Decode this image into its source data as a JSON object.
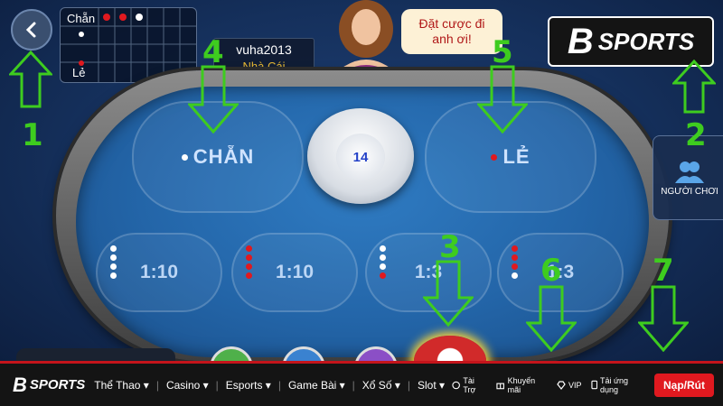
{
  "history": {
    "row_even": "Chẵn",
    "row_odd": "Lẻ"
  },
  "dealer": {
    "username": "vuha2013",
    "role": "Nhà Cái"
  },
  "speech": "Đặt cược đi anh ơi!",
  "brand": {
    "b": "B",
    "sports": "SPORTS"
  },
  "bets": {
    "even": "CHẴN",
    "odd": "LẺ"
  },
  "bowl": {
    "count": "14"
  },
  "sidebar": {
    "players": "NGƯỜI CHƠI"
  },
  "odds": [
    {
      "label": "1:10",
      "dots": [
        "white",
        "white",
        "white",
        "white"
      ]
    },
    {
      "label": "1:10",
      "dots": [
        "red",
        "red",
        "red",
        "red"
      ]
    },
    {
      "label": "1:3",
      "dots": [
        "white",
        "white",
        "white",
        "red"
      ]
    },
    {
      "label": "1:3",
      "dots": [
        "red",
        "red",
        "red",
        "white"
      ]
    }
  ],
  "annotations": [
    "1",
    "2",
    "3",
    "4",
    "5",
    "6",
    "7"
  ],
  "footer": {
    "logo_b": "B",
    "logo_text": "SPORTS",
    "nav": [
      "Thể Thao",
      "Casino",
      "Esports",
      "Game Bài",
      "Xổ Số",
      "Slot"
    ],
    "links": [
      "Tài Trợ",
      "Khuyến mãi",
      "VIP",
      "Tải ứng dụng"
    ],
    "cta": "Nạp/Rút"
  },
  "colors": {
    "accent_green": "#3ecc1f",
    "brand_red": "#e0191f",
    "felt_blue": "#2365a8"
  },
  "icons": [
    "back-arrow-icon",
    "players-icon",
    "tag-icon",
    "gift-icon",
    "diamond-icon",
    "phone-icon"
  ]
}
